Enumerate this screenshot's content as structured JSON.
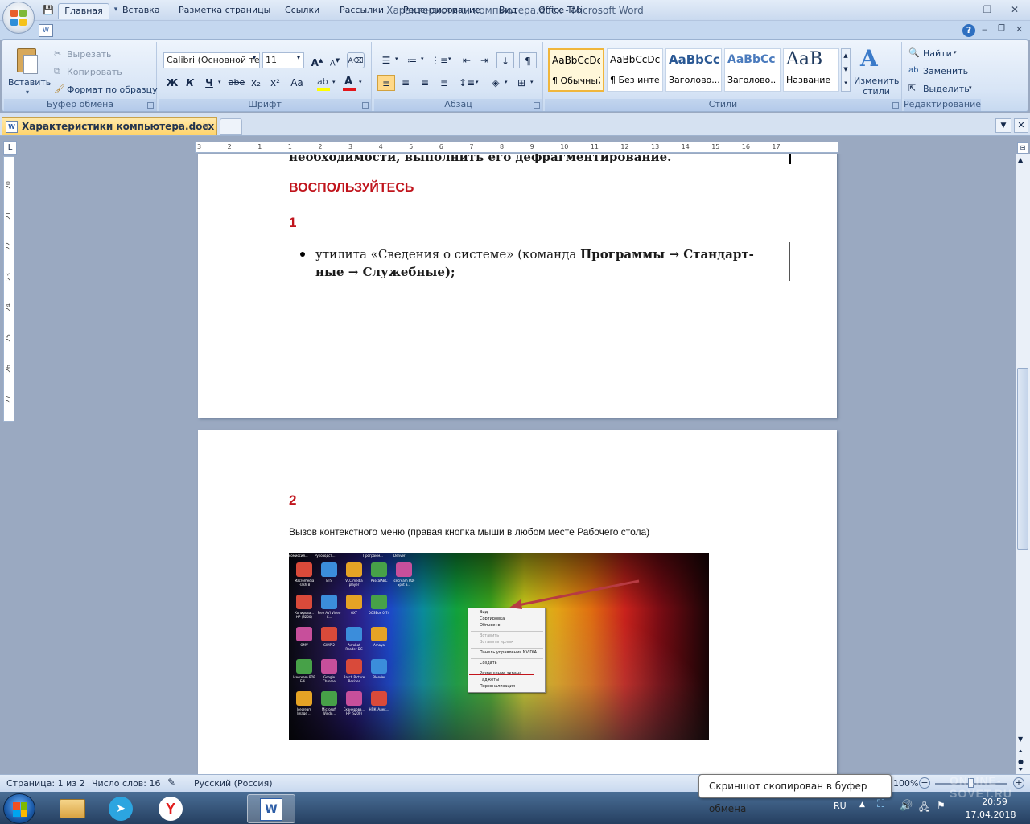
{
  "window": {
    "title": "Характеристики компьютера.docx - Microsoft Word",
    "min_label": "‒",
    "max_label": "❐",
    "close_label": "✕"
  },
  "ribbon_tabs": [
    "Главная",
    "Вставка",
    "Разметка страницы",
    "Ссылки",
    "Рассылки",
    "Рецензирование",
    "Вид",
    "Office Tab"
  ],
  "clipboard": {
    "paste": "Вставить",
    "cut": "Вырезать",
    "copy": "Копировать",
    "format_painter": "Формат по образцу",
    "label": "Буфер обмена"
  },
  "font": {
    "name": "Calibri (Основной те",
    "size": "11",
    "bold": "Ж",
    "italic": "К",
    "underline": "Ч",
    "strike": "abe",
    "sub": "x₂",
    "sup": "x²",
    "case": "Aa",
    "label": "Шрифт"
  },
  "paragraph": {
    "label": "Абзац"
  },
  "styles": {
    "items": [
      {
        "sample": "AaBbCcDc",
        "name": "¶ Обычный"
      },
      {
        "sample": "AaBbCcDc",
        "name": "¶ Без инте..."
      },
      {
        "sample": "AaBbCc",
        "name": "Заголово..."
      },
      {
        "sample": "AaBbCc",
        "name": "Заголово..."
      },
      {
        "sample": "AaB",
        "name": "Название"
      }
    ],
    "change_label": "Изменить стили",
    "label": "Стили"
  },
  "editing": {
    "find": "Найти",
    "replace": "Заменить",
    "select": "Выделить",
    "label": "Редактирование"
  },
  "doc_tab": {
    "title": "Характеристики компьютера.docx",
    "close": "✕"
  },
  "ruler": {
    "h_ticks": [
      "3",
      "2",
      "1",
      "1",
      "2",
      "3",
      "4",
      "5",
      "6",
      "7",
      "8",
      "9",
      "10",
      "11",
      "12",
      "13",
      "14",
      "15",
      "16",
      "17"
    ],
    "v_ticks": [
      "20",
      "21",
      "22",
      "23",
      "24",
      "25",
      "26",
      "27"
    ]
  },
  "document": {
    "top_cut_text": "необходимости, выполнить его дефрагментирование.",
    "heading": "ВОСПОЛЬЗУЙТЕСЬ",
    "num1": "1",
    "bullet_line1_a": "утилита «Сведения о системе» (команда ",
    "bullet_line1_b": "Программы → Стандарт-",
    "bullet_line2": "ные → Служебные);",
    "num2": "2",
    "caption": "Вызов контекстного меню (правая кнопка мыши в любом месте Рабочего стола)",
    "context_menu": [
      "Вид",
      "Сортировка",
      "Обновить",
      "",
      "Вставить",
      "Вставить ярлык",
      "",
      "Панель управления NVIDIA",
      "",
      "Создать",
      "",
      "Разрешение экрана",
      "Гаджеты",
      "Персонализация"
    ],
    "desktop_icons": [
      "Macromedia Flash 8",
      "ETS",
      "VLC media player",
      "PascalABC",
      "Icecream PDF Split a...",
      "Копирова... HP (S200)",
      "Free AVI Video C...",
      "OXT",
      "DOSBox 0.74",
      "OMV",
      "GIMP 2",
      "Acrobat Reader DC",
      "Amaya",
      "Icecream PDF Edi...",
      "Google Chrome",
      "Batch Picture Resizer",
      "Blender",
      "Icecream Image ...",
      "Microsoft Windo...",
      "Сканирова... HP (S200)",
      "НПК_Алек...",
      "комиссия...",
      "Руководст...",
      "Программ...",
      "Denver"
    ]
  },
  "statusbar": {
    "page": "Страница: 1 из 2",
    "words": "Число слов: 16",
    "lang": "Русский (Россия)",
    "zoom": "100%"
  },
  "tooltip": "Скриншот скопирован в буфер обмена",
  "taskbar": {
    "lang": "RU",
    "time": "20:59",
    "date": "17.04.2018"
  },
  "watermark": "ONLINE-SOVET.RU"
}
